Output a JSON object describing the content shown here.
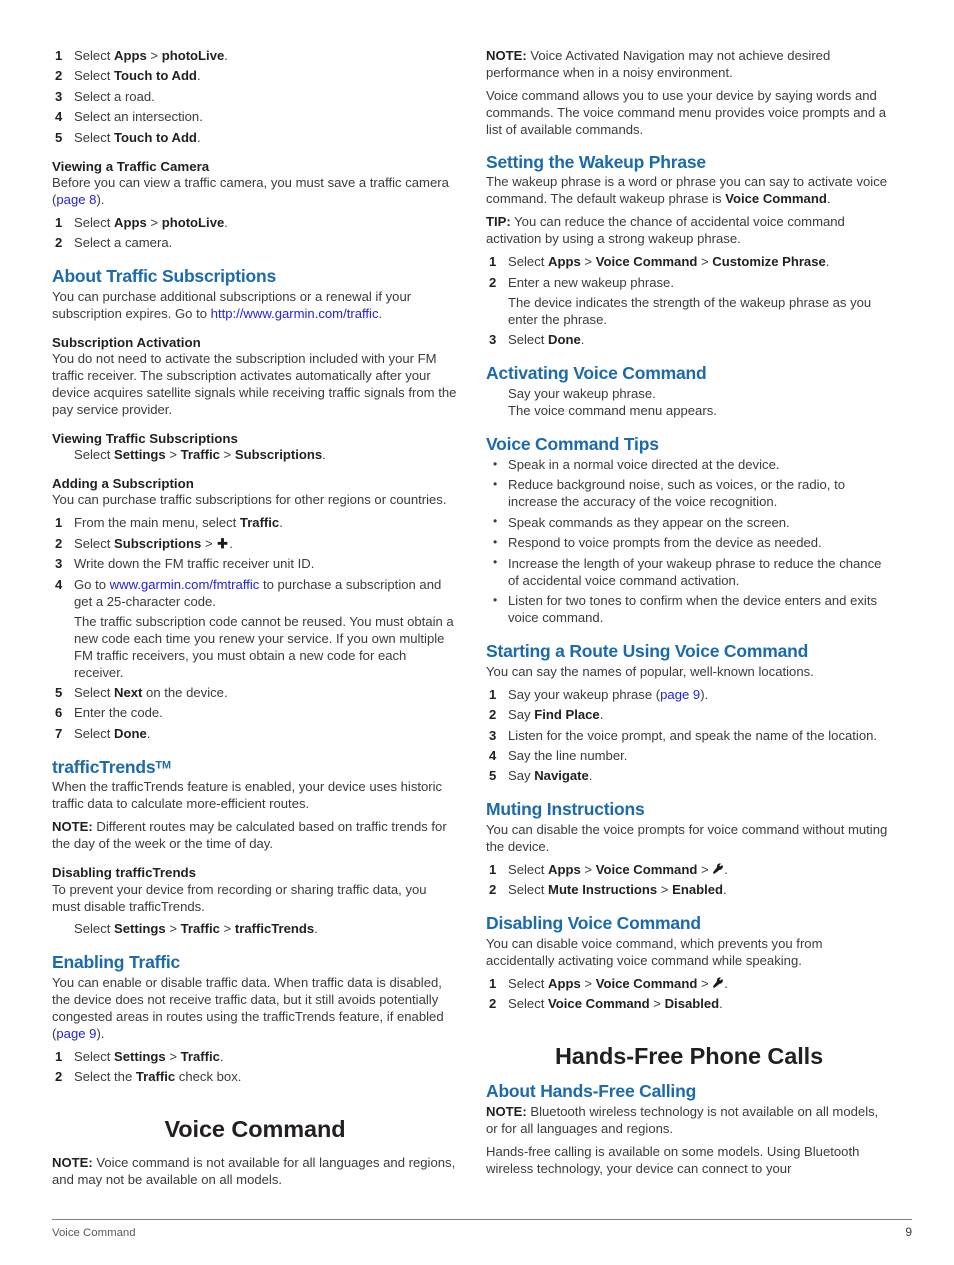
{
  "page": {
    "footer_label": "Voice Command",
    "footer_page_number": "9",
    "accent_heading_color": "#1a6aad",
    "link_color": "#2222dd",
    "body_text_color": "#3b3b3d"
  },
  "left_column": {
    "photolive_steps": [
      {
        "pre": "Select ",
        "bold": "Apps",
        "mid": " > ",
        "bold2": "photoLive",
        "post": "."
      },
      {
        "pre": "Select ",
        "bold": "Touch to Add",
        "post": "."
      },
      {
        "pre": "Select a road.",
        "post": ""
      },
      {
        "pre": "Select an intersection.",
        "post": ""
      },
      {
        "pre": "Select ",
        "bold": "Touch to Add",
        "post": "."
      }
    ],
    "viewing_traffic_camera": {
      "heading": "Viewing a Traffic Camera",
      "intro_pre": "Before you can view a traffic camera, you must save a traffic camera (",
      "intro_link": "page 8",
      "intro_post": ").",
      "steps": [
        {
          "pre": "Select ",
          "bold": "Apps",
          "mid": " > ",
          "bold2": "photoLive",
          "post": "."
        },
        {
          "pre": "Select a camera.",
          "post": ""
        }
      ]
    },
    "about_traffic_subscriptions": {
      "heading": "About Traffic Subscriptions",
      "body_pre": "You can purchase additional subscriptions or a renewal if your subscription expires. Go to ",
      "body_link": "http://www.garmin.com/traffic",
      "body_post": "."
    },
    "subscription_activation": {
      "heading": "Subscription Activation",
      "body": "You do not need to activate the subscription included with your FM traffic receiver. The subscription activates automatically after your device acquires satellite signals while receiving traffic signals from the pay service provider."
    },
    "viewing_traffic_subscriptions": {
      "heading": "Viewing Traffic Subscriptions",
      "step_pre": "Select ",
      "step_b1": "Settings",
      "step_m1": " > ",
      "step_b2": "Traffic",
      "step_m2": " > ",
      "step_b3": "Subscriptions",
      "step_post": "."
    },
    "adding_a_subscription": {
      "heading": "Adding a Subscription",
      "intro": "You can purchase traffic subscriptions for other regions or countries.",
      "step1_pre": "From the main menu, select ",
      "step1_bold": "Traffic",
      "step1_post": ".",
      "step2_pre": "Select ",
      "step2_bold": "Subscriptions",
      "step2_mid": " > ",
      "step2_icon": "plus-icon",
      "step2_post": ".",
      "step3": "Write down the FM traffic receiver unit ID.",
      "step4_pre": "Go to ",
      "step4_link": "www.garmin.com/fmtraffic",
      "step4_post": " to purchase a subscription and get a 25-character code.",
      "step4_note": "The traffic subscription code cannot be reused. You must obtain a new code each time you renew your service. If you own multiple FM traffic receivers, you must obtain a new code for each receiver.",
      "step5_pre": "Select ",
      "step5_bold": "Next",
      "step5_post": " on the device.",
      "step6": "Enter the code.",
      "step7_pre": "Select ",
      "step7_bold": "Done",
      "step7_post": "."
    },
    "traffictrends": {
      "heading": "trafficTrends",
      "heading_tm": "TM",
      "body": "When the trafficTrends feature is enabled, your device uses historic traffic data to calculate more-efficient routes.",
      "note_label": "NOTE:",
      "note_body": " Different routes may be calculated based on traffic trends for the day of the week or the time of day."
    },
    "disabling_traffictrends": {
      "heading": "Disabling trafficTrends",
      "body": "To prevent your device from recording or sharing traffic data, you must disable trafficTrends.",
      "step_pre": "Select ",
      "step_b1": "Settings",
      "step_m1": " > ",
      "step_b2": "Traffic",
      "step_m2": " > ",
      "step_b3": "trafficTrends",
      "step_post": "."
    },
    "enabling_traffic": {
      "heading": "Enabling Traffic",
      "body_pre": "You can enable or disable traffic data. When traffic data is disabled, the device does not receive traffic data, but it still avoids potentially congested areas in routes using the trafficTrends feature, if enabled (",
      "body_link": "page 9",
      "body_post": ").",
      "step1_pre": "Select ",
      "step1_b1": "Settings",
      "step1_m1": " > ",
      "step1_b2": "Traffic",
      "step1_post": ".",
      "step2_pre": "Select the ",
      "step2_bold": "Traffic",
      "step2_post": " check box."
    },
    "voice_command_chapter": {
      "title": "Voice Command",
      "note_label": "NOTE:",
      "note_body": " Voice command is not available for all languages and regions, and may not be available on all models."
    }
  },
  "right_column": {
    "intro_note": {
      "label": "NOTE:",
      "body": " Voice Activated Navigation may not achieve desired performance when in a noisy environment."
    },
    "intro_body": "Voice command allows you to use your device by saying words and commands. The voice command menu provides voice prompts and a list of available commands.",
    "setting_wakeup_phrase": {
      "heading": "Setting the Wakeup Phrase",
      "body_pre": "The wakeup phrase is a word or phrase you can say to activate voice command. The default wakeup phrase is ",
      "body_bold": "Voice Command",
      "body_post": ".",
      "tip_label": "TIP:",
      "tip_body": " You can reduce the chance of accidental voice command activation by using a strong wakeup phrase.",
      "step1_pre": "Select ",
      "step1_b1": "Apps",
      "step1_m1": " > ",
      "step1_b2": "Voice Command",
      "step1_m2": " > ",
      "step1_b3": "Customize Phrase",
      "step1_post": ".",
      "step2": "Enter a new wakeup phrase.",
      "step2_note": "The device indicates the strength of the wakeup phrase as you enter the phrase.",
      "step3_pre": "Select ",
      "step3_bold": "Done",
      "step3_post": "."
    },
    "activating_voice_command": {
      "heading": "Activating Voice Command",
      "line1": "Say your wakeup phrase.",
      "line2": "The voice command menu appears."
    },
    "voice_command_tips": {
      "heading": "Voice Command Tips",
      "bullets": [
        "Speak in a normal voice directed at the device.",
        "Reduce background noise, such as voices, or the radio, to increase the accuracy of the voice recognition.",
        "Speak commands as they appear on the screen.",
        "Respond to voice prompts from the device as needed.",
        "Increase the length of your wakeup phrase to reduce the chance of accidental voice command activation.",
        "Listen for two tones to confirm when the device enters and exits voice command."
      ]
    },
    "starting_route": {
      "heading": "Starting a Route Using Voice Command",
      "intro": "You can say the names of popular, well-known locations.",
      "step1_pre": "Say your wakeup phrase (",
      "step1_link": "page 9",
      "step1_post": ").",
      "step2_pre": "Say ",
      "step2_bold": "Find Place",
      "step2_post": ".",
      "step3": "Listen for the voice prompt, and speak the name of the location.",
      "step4": "Say the line number.",
      "step5_pre": "Say ",
      "step5_bold": "Navigate",
      "step5_post": "."
    },
    "muting_instructions": {
      "heading": "Muting Instructions",
      "body": "You can disable the voice prompts for voice command without muting the device.",
      "step1_pre": "Select ",
      "step1_b1": "Apps",
      "step1_m1": " > ",
      "step1_b2": "Voice Command",
      "step1_m2": " > ",
      "step1_icon": "wrench-icon",
      "step1_post": ".",
      "step2_pre": "Select ",
      "step2_b1": "Mute Instructions",
      "step2_m1": " > ",
      "step2_b2": "Enabled",
      "step2_post": "."
    },
    "disabling_voice_command": {
      "heading": "Disabling Voice Command",
      "body": "You can disable voice command, which prevents you from accidentally activating voice command while speaking.",
      "step1_pre": "Select ",
      "step1_b1": "Apps",
      "step1_m1": " > ",
      "step1_b2": "Voice Command",
      "step1_m2": " > ",
      "step1_icon": "wrench-icon",
      "step1_post": ".",
      "step2_pre": "Select ",
      "step2_b1": "Voice Command",
      "step2_m1": " > ",
      "step2_b2": "Disabled",
      "step2_post": "."
    },
    "hands_free_chapter": {
      "title": "Hands-Free Phone Calls"
    },
    "about_hands_free_calling": {
      "heading": "About Hands-Free Calling",
      "note_label": "NOTE:",
      "note_body": " Bluetooth wireless technology is not available on all models, or for all languages and regions.",
      "body": "Hands-free calling is available on some models. Using Bluetooth wireless technology, your device can connect to your"
    }
  }
}
